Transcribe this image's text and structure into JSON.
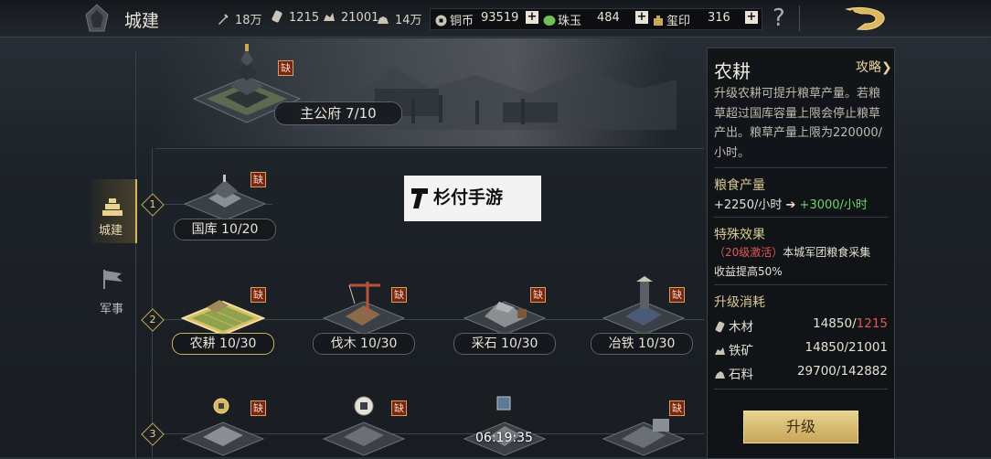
{
  "header": {
    "title": "城建",
    "resources": [
      {
        "icon": "sword-troops-icon",
        "value": "18万"
      },
      {
        "icon": "wood-icon",
        "value": "1215"
      },
      {
        "icon": "iron-ore-icon",
        "value": "21001"
      },
      {
        "icon": "stone-icon",
        "value": "14万"
      }
    ],
    "currencies": [
      {
        "icon": "copper-coin-icon",
        "label": "铜币",
        "value": "93519"
      },
      {
        "icon": "jade-icon",
        "label": "珠玉",
        "value": "484"
      },
      {
        "icon": "seal-icon",
        "label": "玺印",
        "value": "316"
      }
    ],
    "plus": "+",
    "help": "?"
  },
  "nav": [
    {
      "label": "城建",
      "icon": "city-build-icon",
      "active": true
    },
    {
      "label": "军事",
      "icon": "military-flag-icon",
      "active": false
    }
  ],
  "missing_badge": "缺",
  "main_building": {
    "label": "主公府 7/10"
  },
  "tiers": [
    "1",
    "2",
    "3"
  ],
  "tier1": [
    {
      "label": "国库 10/20"
    }
  ],
  "tier2": [
    {
      "label": "农耕 10/30"
    },
    {
      "label": "伐木 10/30"
    },
    {
      "label": "采石 10/30"
    },
    {
      "label": "冶铁 10/30"
    }
  ],
  "tier3": {
    "timer": "06:19:35"
  },
  "watermark": "杉付手游",
  "panel": {
    "title": "农耕",
    "guide": "攻略❯",
    "description": "升级农耕可提升粮草产量。若粮草超过国库容量上限会停止粮草产出。粮草产量上限为220000/小时。",
    "production_title": "粮食产量",
    "production_current": "+2250/小时",
    "production_arrow": "➔",
    "production_next": "+3000/小时",
    "special_title": "特殊效果",
    "special_badge": "（20级激活）",
    "special_text_1": "本城军团粮食采集",
    "special_text_2": "收益提高50%",
    "cost_title": "升级消耗",
    "costs": [
      {
        "icon": "wood-icon",
        "name": "木材",
        "required": "14850",
        "separator": "/",
        "owned": "1215",
        "insufficient": true
      },
      {
        "icon": "iron-ore-icon",
        "name": "铁矿",
        "required": "14850",
        "separator": "/",
        "owned": "21001",
        "insufficient": false
      },
      {
        "icon": "stone-icon",
        "name": "石料",
        "required": "29700",
        "separator": "/",
        "owned": "142882",
        "insufficient": false
      }
    ],
    "upgrade_label": "升级"
  },
  "colors": {
    "accent_gold": "#d6b866",
    "insufficient_red": "#e05757",
    "gain_green": "#6ed26e",
    "missing_badge": "#7a2418"
  }
}
